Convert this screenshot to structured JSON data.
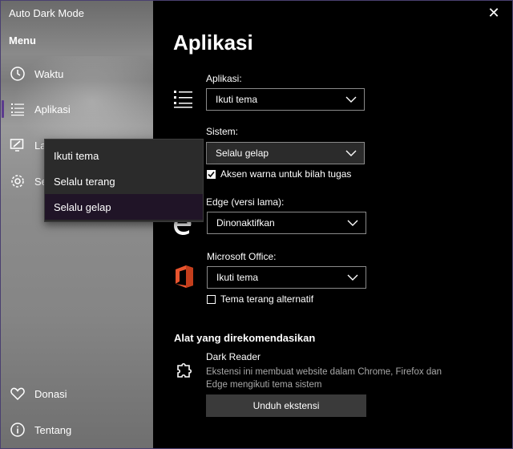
{
  "window": {
    "title": "Auto Dark Mode",
    "close_glyph": "✕"
  },
  "sidebar": {
    "menu_label": "Menu",
    "items": [
      {
        "label": "Waktu",
        "icon": "clock-icon"
      },
      {
        "label": "Aplikasi",
        "icon": "list-icon",
        "selected": true
      },
      {
        "label": "La",
        "icon": "desktop-brush-icon"
      },
      {
        "label": "Se",
        "icon": "gear-icon"
      }
    ],
    "bottom_items": [
      {
        "label": "Donasi",
        "icon": "heart-icon"
      },
      {
        "label": "Tentang",
        "icon": "info-icon"
      }
    ],
    "accent": "#5b3a8e"
  },
  "flyout": {
    "options": [
      "Ikuti tema",
      "Selalu terang",
      "Selalu gelap"
    ],
    "selected": "Selalu gelap"
  },
  "main": {
    "title": "Aplikasi",
    "apps_label": "Aplikasi:",
    "apps_value": "Ikuti tema",
    "system_label": "Sistem:",
    "system_value": "Selalu gelap",
    "accent_checkbox_label": "Aksen warna untuk bilah tugas",
    "accent_checkbox_checked": true,
    "edge_label": "Edge (versi lama):",
    "edge_value": "Dinonaktifkan",
    "office_label": "Microsoft Office:",
    "office_value": "Ikuti tema",
    "office_checkbox_label": "Tema terang alternatif",
    "office_checkbox_checked": false,
    "recommended_title": "Alat yang direkomendasikan",
    "recommended_name": "Dark Reader",
    "recommended_desc": "Ekstensi ini membuat website dalam Chrome, Firefox dan Edge mengikuti tema sistem",
    "download_button": "Unduh ekstensi",
    "office_icon_color": "#e8542e"
  }
}
